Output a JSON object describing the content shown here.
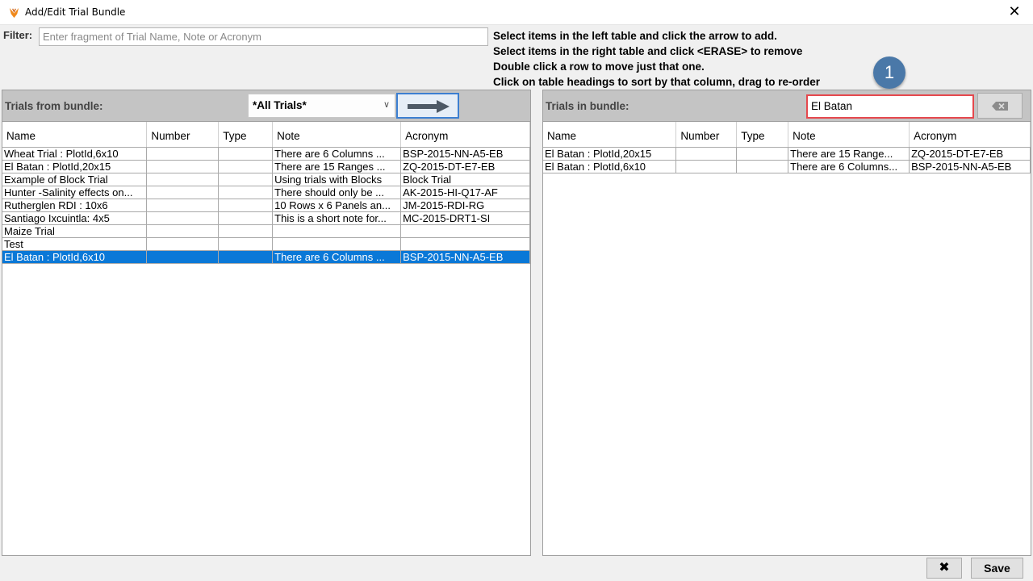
{
  "window": {
    "title": "Add/Edit Trial Bundle",
    "close_glyph": "✕"
  },
  "filter": {
    "label": "Filter:",
    "placeholder": "Enter fragment of Trial Name, Note or Acronym",
    "value": ""
  },
  "instructions": [
    "Select items in the left table and click the arrow to add.",
    "Select items in the right table and click <ERASE> to remove",
    "Double click a row to move just that one.",
    "Click on table headings to sort by that column, drag to re-order"
  ],
  "badge": {
    "number": "1",
    "color": "#4a78a8"
  },
  "left_panel": {
    "title": "Trials from bundle:",
    "dropdown": {
      "selected": "*All Trials*"
    },
    "arrow_icon": "arrow-right-icon",
    "columns": [
      "Name",
      "Number",
      "Type",
      "Note",
      "Acronym"
    ],
    "rows": [
      [
        "Wheat Trial : PlotId,6x10",
        "",
        "",
        "There are 6 Columns ...",
        "BSP-2015-NN-A5-EB"
      ],
      [
        "El Batan : PlotId,20x15",
        "",
        "",
        "There are 15 Ranges ...",
        "ZQ-2015-DT-E7-EB"
      ],
      [
        "Example of Block Trial",
        "",
        "",
        "Using trials with Blocks",
        "Block Trial"
      ],
      [
        "Hunter -Salinity effects on...",
        "",
        "",
        "There should only be ...",
        "AK-2015-HI-Q17-AF"
      ],
      [
        "Rutherglen RDI : 10x6",
        "",
        "",
        "10 Rows x 6 Panels an...",
        "JM-2015-RDI-RG"
      ],
      [
        "Santiago Ixcuintla: 4x5",
        "",
        "",
        "This is a short note for...",
        "MC-2015-DRT1-SI"
      ],
      [
        "Maize Trial",
        "",
        "",
        "",
        ""
      ],
      [
        "Test",
        "",
        "",
        "",
        ""
      ],
      [
        "El Batan : PlotId,6x10",
        "",
        "",
        "There are 6 Columns ...",
        "BSP-2015-NN-A5-EB"
      ]
    ],
    "selected_row": 8
  },
  "right_panel": {
    "title": "Trials in bundle:",
    "search_value": "El Batan",
    "erase_icon": "backspace-erase-icon",
    "columns": [
      "Name",
      "Number",
      "Type",
      "Note",
      "Acronym"
    ],
    "rows": [
      [
        "El Batan : PlotId,20x15",
        "",
        "",
        "There are 15 Range...",
        "ZQ-2015-DT-E7-EB"
      ],
      [
        "El Batan : PlotId,6x10",
        "",
        "",
        "There are 6 Columns...",
        "BSP-2015-NN-A5-EB"
      ]
    ]
  },
  "buttons": {
    "cancel": "✖",
    "save": "Save"
  },
  "colors": {
    "selection": "#0a78d7",
    "highlight_border": "#e5484d",
    "arrow_button_border": "#3c7fd1",
    "header_bg": "#c4c4c4"
  }
}
